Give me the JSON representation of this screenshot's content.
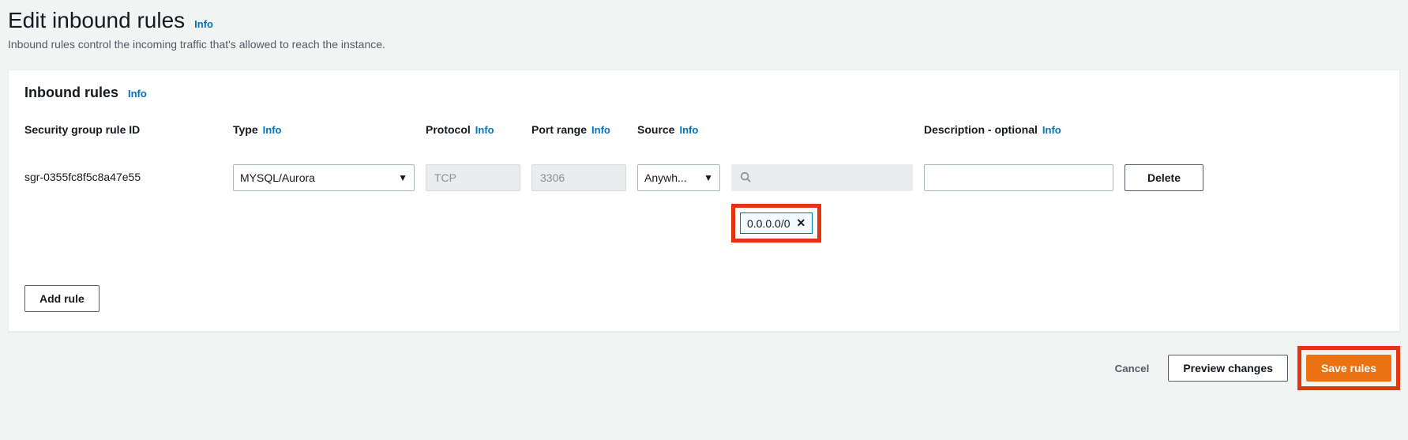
{
  "page": {
    "title": "Edit inbound rules",
    "info": "Info",
    "description": "Inbound rules control the incoming traffic that's allowed to reach the instance."
  },
  "panel": {
    "title": "Inbound rules",
    "info": "Info"
  },
  "columns": {
    "ruleId": "Security group rule ID",
    "type": "Type",
    "typeInfo": "Info",
    "protocol": "Protocol",
    "protocolInfo": "Info",
    "portRange": "Port range",
    "portRangeInfo": "Info",
    "source": "Source",
    "sourceInfo": "Info",
    "description": "Description - optional",
    "descriptionInfo": "Info"
  },
  "rule": {
    "id": "sgr-0355fc8f5c8a47e55",
    "type": "MYSQL/Aurora",
    "protocol": "TCP",
    "portRange": "3306",
    "sourceMode": "Anywh...",
    "cidr": "0.0.0.0/0",
    "description": ""
  },
  "buttons": {
    "delete": "Delete",
    "addRule": "Add rule",
    "cancel": "Cancel",
    "preview": "Preview changes",
    "save": "Save rules"
  }
}
